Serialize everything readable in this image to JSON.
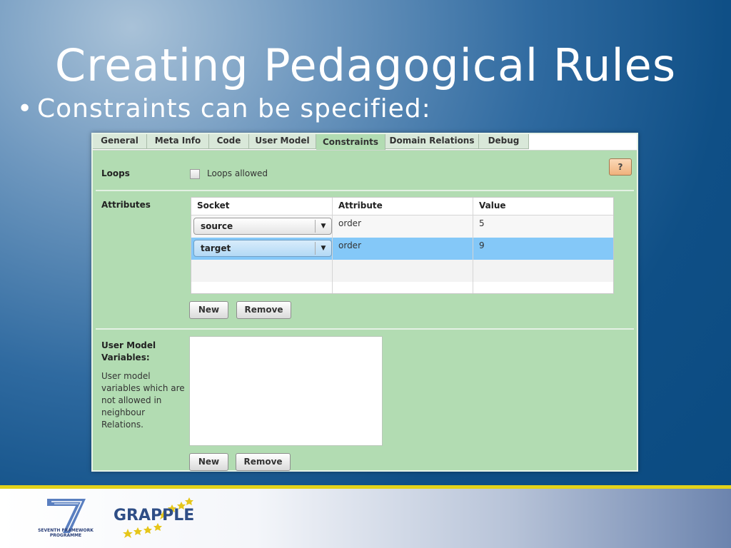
{
  "slide": {
    "title": "Creating Pedagogical Rules",
    "bullet_marker": "•",
    "bullet": "Constraints can be specified:"
  },
  "tabs": [
    "General",
    "Meta Info",
    "Code",
    "User Model",
    "Constraints",
    "Domain Relations",
    "Debug"
  ],
  "active_tab": "Constraints",
  "help_label": "?",
  "loops": {
    "label": "Loops",
    "checkbox_label": "Loops allowed",
    "checked": false
  },
  "attributes": {
    "label": "Attributes",
    "columns": [
      "Socket",
      "Attribute",
      "Value"
    ],
    "rows": [
      {
        "socket": "source",
        "attribute": "order",
        "value": "5"
      },
      {
        "socket": "target",
        "attribute": "order",
        "value": "9"
      }
    ],
    "new_label": "New",
    "remove_label": "Remove"
  },
  "user_model": {
    "label": "User Model Variables:",
    "description": "User model variables which are not allowed in neighbour Relations.",
    "new_label": "New",
    "remove_label": "Remove"
  },
  "footer": {
    "fp7_text": "SEVENTH FRAMEWORK PROGRAMME",
    "grapple_text": "GRAPPLE"
  },
  "colors": {
    "panel_bg": "#b2dcb2",
    "selected_row": "#84c8f8",
    "help_button": "#f0b27c",
    "footer_rule": "#e3d21a"
  }
}
